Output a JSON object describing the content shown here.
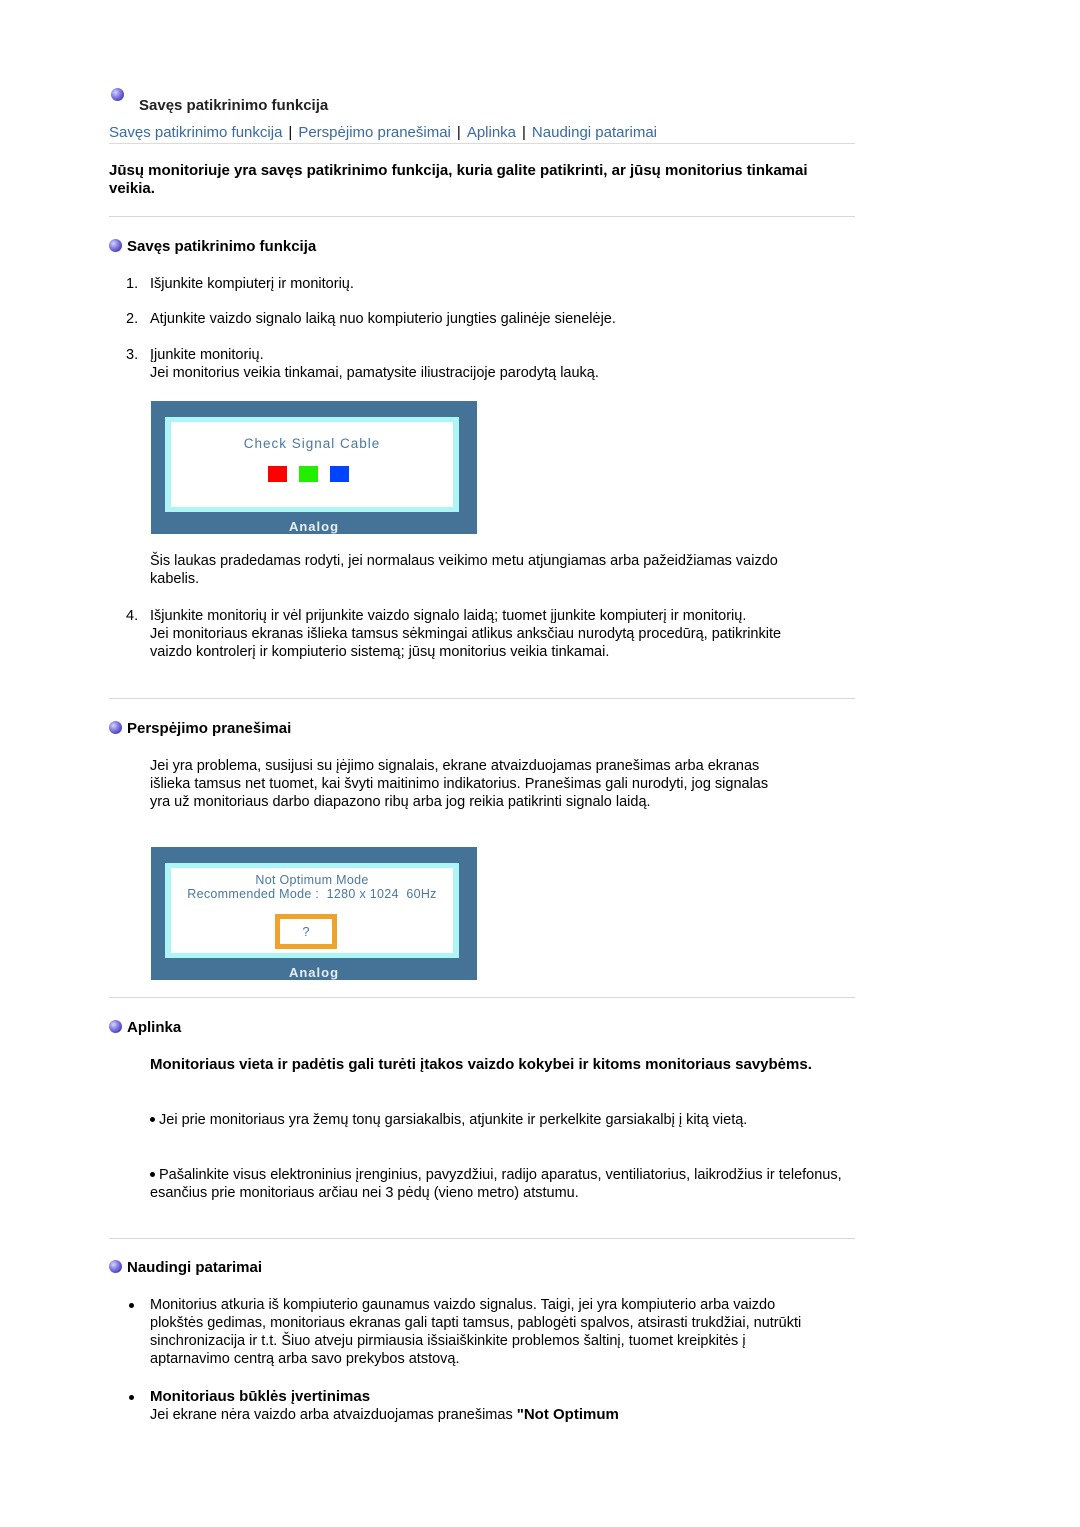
{
  "header": {
    "title": "Savęs patikrinimo funkcija",
    "icon": "purple-orb-bullet-icon"
  },
  "nav": {
    "links": [
      "Savęs patikrinimo funkcija",
      "Perspėjimo pranešimai",
      "Aplinka",
      "Naudingi patarimai"
    ],
    "separator": "|"
  },
  "intro": "Jūsų monitoriuje yra savęs patikrinimo funkcija, kuria galite patikrinti, ar jūsų monitorius tinkamai veikia.",
  "self_test": {
    "heading": "Savęs patikrinimo funkcija",
    "steps": [
      {
        "num": "1.",
        "text": "Išjunkite kompiuterį ir monitorių."
      },
      {
        "num": "2.",
        "text": "Atjunkite vaizdo signalo laiką nuo kompiuterio jungties galinėje sienelėje."
      },
      {
        "num": "3.",
        "text": "Įjunkite monitorių.",
        "extra": "Jei monitorius veikia tinkamai, pamatysite iliustracijoje parodytą lauką."
      },
      {
        "num": "4.",
        "text": "Išjunkite monitorių ir vėl prijunkite vaizdo signalo laidą; tuomet įjunkite kompiuterį ir monitorių.",
        "extra": "Jei monitoriaus ekranas išlieka tamsus sėkmingai atlikus anksčiau nurodytą procedūrą, patikrinkite vaizdo kontrolerį ir kompiuterio sistemą; jūsų monitorius veikia tinkamai."
      }
    ],
    "screen1": {
      "message": "Check Signal Cable",
      "label": "Analog",
      "squares": [
        "#ff0000",
        "#22ee00",
        "#0044ff"
      ]
    },
    "after_image_text": "Šis laukas pradedamas rodyti, jei normalaus veikimo metu atjungiamas arba pažeidžiamas vaizdo kabelis."
  },
  "warnings": {
    "heading": "Perspėjimo pranešimai",
    "text": "Jei yra problema, susijusi su įėjimo signalais, ekrane atvaizduojamas pranešimas arba ekranas išlieka tamsus net tuomet, kai švyti maitinimo indikatorius. Pranešimas gali nurodyti, jog signalas yra už monitoriaus darbo diapazono ribų arba jog reikia patikrinti signalo laidą.",
    "screen2": {
      "line1": "Not Optimum Mode",
      "line2": "Recommended Mode :  1280 x 1024  60Hz",
      "box": "?",
      "label": "Analog"
    }
  },
  "environment": {
    "heading": "Aplinka",
    "bold_text": "Monitoriaus vieta ir padėtis gali turėti įtakos vaizdo kokybei ir kitoms monitoriaus savybėms.",
    "bullets": [
      "Jei prie monitoriaus yra žemų tonų garsiakalbis, atjunkite ir perkelkite garsiakalbį į kitą vietą.",
      "Pašalinkite visus elektroninius įrenginius, pavyzdžiui, radijo aparatus, ventiliatorius, laikrodžius ir telefonus, esančius prie monitoriaus arčiau nei 3 pėdų (vieno metro) atstumu."
    ]
  },
  "tips": {
    "heading": "Naudingi patarimai",
    "bullet1": "Monitorius atkuria iš kompiuterio gaunamus vaizdo signalus. Taigi, jei yra kompiuterio arba vaizdo plokštės gedimas, monitoriaus ekranas gali tapti tamsus, pablogėti spalvos, atsirasti trukdžiai, nutrūkti sinchronizacija ir t.t. Šiuo atveju pirmiausia išsiaiškinkite problemos šaltinį, tuomet kreipkitės į aptarnavimo centrą arba savo prekybos atstovą.",
    "bullet2_title": "Monitoriaus būklės įvertinimas",
    "bullet2_text": "Jei ekrane nėra vaizdo arba atvaizduojamas pranešimas ",
    "bullet2_bold": "\"Not Optimum"
  }
}
